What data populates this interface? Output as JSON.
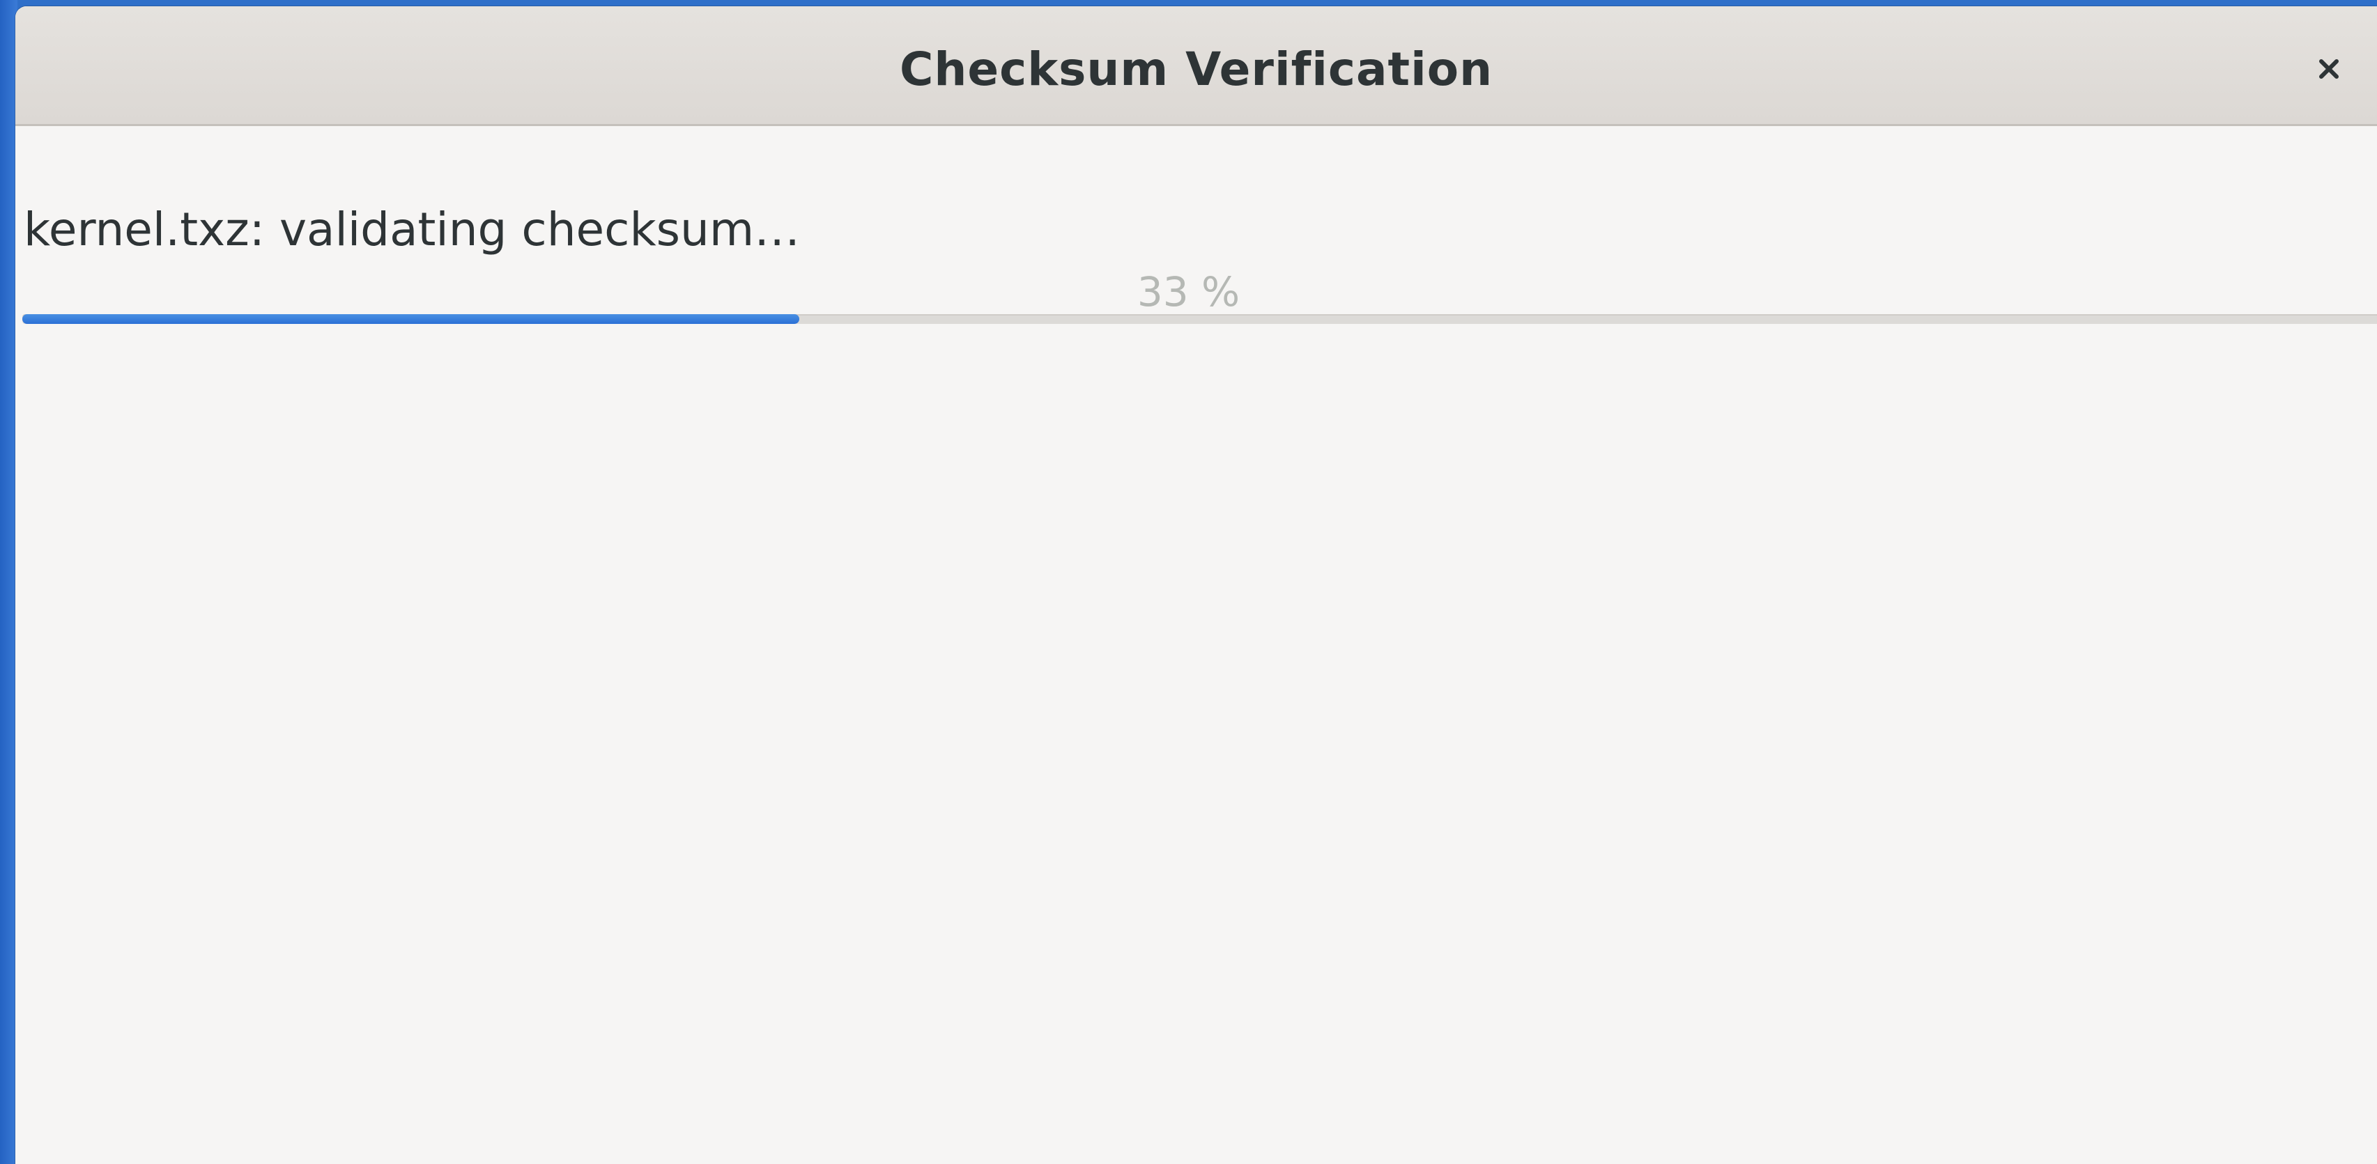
{
  "window": {
    "title": "Checksum Verification",
    "close_icon": "close-icon"
  },
  "progress": {
    "status_text": "kernel.txz: validating checksum…",
    "percent_label": "33 %",
    "fraction": 0.33,
    "accent_color": "#3584e4"
  }
}
